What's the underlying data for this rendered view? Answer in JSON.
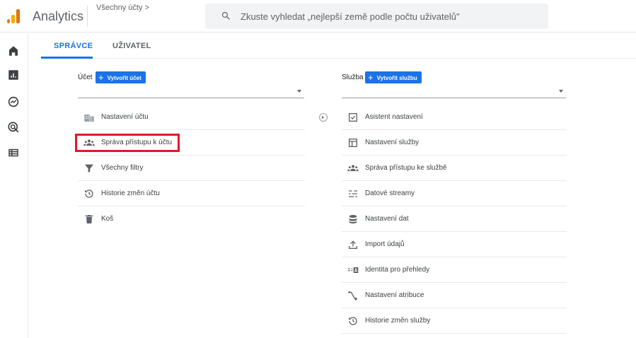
{
  "header": {
    "app_title": "Analytics",
    "breadcrumb": "Všechny účty >",
    "search_placeholder": "Zkuste vyhledat „nejlepší země podle počtu uživatelů\""
  },
  "leftnav": {
    "icons": [
      "home-icon",
      "reports-icon",
      "explore-icon",
      "advertising-icon",
      "configure-icon"
    ]
  },
  "tabs": {
    "admin": "SPRÁVCE",
    "user": "UŽIVATEL"
  },
  "account_column": {
    "label": "Účet",
    "create_button": "Vytvořit účet",
    "items": [
      {
        "label": "Nastavení účtu",
        "icon": "building-icon"
      },
      {
        "label": "Správa přístupu k účtu",
        "icon": "people-icon"
      },
      {
        "label": "Všechny filtry",
        "icon": "filter-icon"
      },
      {
        "label": "Historie změn účtu",
        "icon": "history-icon"
      },
      {
        "label": "Koš",
        "icon": "trash-icon"
      }
    ]
  },
  "property_column": {
    "label": "Služba",
    "create_button": "Vytvořit službu",
    "items": [
      {
        "label": "Asistent nastavení",
        "icon": "checklist-icon"
      },
      {
        "label": "Nastavení služby",
        "icon": "property-settings-icon"
      },
      {
        "label": "Správa přístupu ke službě",
        "icon": "people-icon"
      },
      {
        "label": "Datové streamy",
        "icon": "streams-icon"
      },
      {
        "label": "Nastavení dat",
        "icon": "database-icon"
      },
      {
        "label": "Import údajů",
        "icon": "upload-icon"
      },
      {
        "label": "Identita pro přehledy",
        "icon": "identity-icon"
      },
      {
        "label": "Nastavení atribuce",
        "icon": "attribution-icon"
      },
      {
        "label": "Historie změn služby",
        "icon": "history-icon"
      }
    ]
  },
  "colors": {
    "accent": "#1a73e8",
    "highlight": "#e8142b"
  }
}
